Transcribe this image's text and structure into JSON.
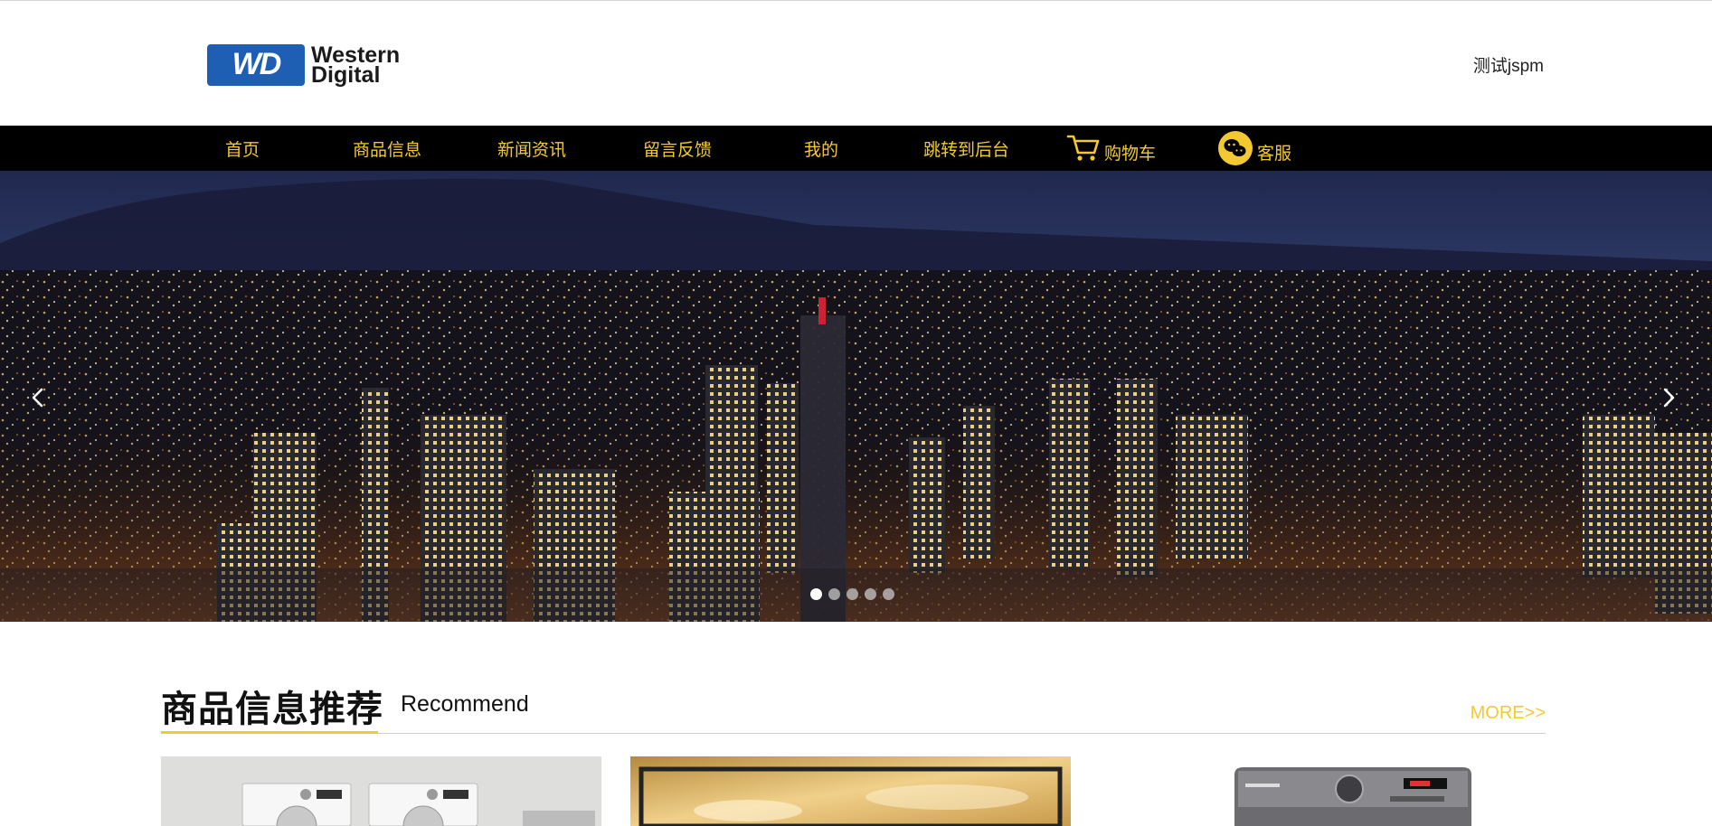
{
  "header": {
    "logo_text_line1": "Western",
    "logo_text_line2": "Digital",
    "logo_mark": "WD",
    "user_name": "测试jspm"
  },
  "nav": {
    "items": [
      {
        "label": "首页"
      },
      {
        "label": "商品信息"
      },
      {
        "label": "新闻资讯"
      },
      {
        "label": "留言反馈"
      },
      {
        "label": "我的"
      },
      {
        "label": "跳转到后台"
      },
      {
        "label": "购物车",
        "icon": "cart-icon"
      },
      {
        "label": "客服",
        "icon": "wechat-icon"
      }
    ]
  },
  "banner": {
    "slide_count": 5,
    "active_slide": 1,
    "prev_icon": "chevron-left-icon",
    "next_icon": "chevron-right-icon"
  },
  "recommend": {
    "title": "商品信息推荐",
    "subtitle": "Recommend",
    "more_label": "MORE>>"
  },
  "colors": {
    "accent": "#f3c933",
    "nav_bg": "#000000",
    "logo_blue": "#1e5fb4"
  }
}
